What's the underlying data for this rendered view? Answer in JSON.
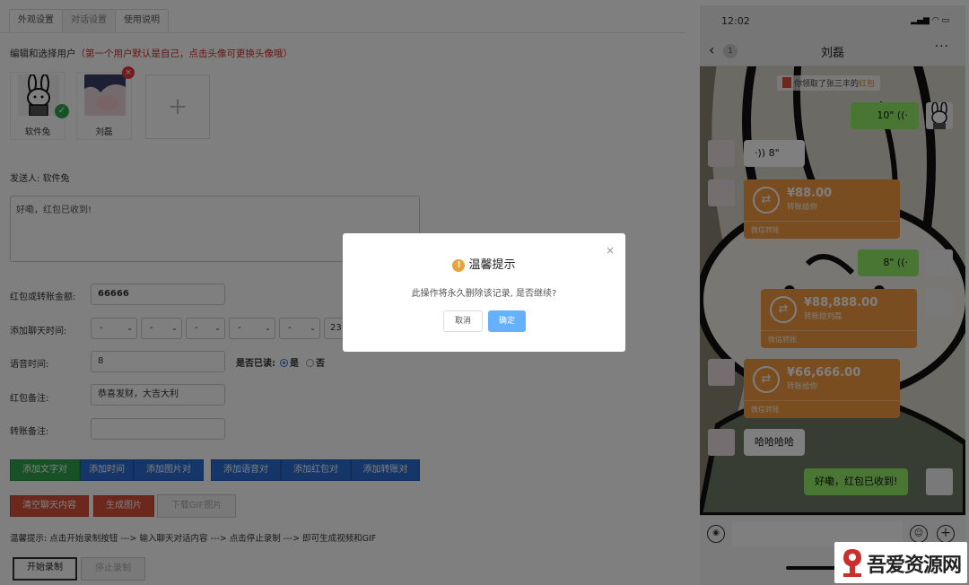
{
  "tabs": [
    {
      "label": "外观设置"
    },
    {
      "label": "对话设置"
    },
    {
      "label": "使用说明"
    }
  ],
  "users_header": {
    "prefix": "编辑和选择用户",
    "note": "（第一个用户默认是自己，点击头像可更换头像哦）"
  },
  "users": [
    {
      "name": "软件兔"
    },
    {
      "name": "刘磊"
    }
  ],
  "add_symbol": "+",
  "sender": {
    "label": "发送人:",
    "name": "软件兔"
  },
  "message_text": "好嘞，红包已收到!",
  "form": {
    "amount_label": "红包或转账金额:",
    "amount_value": "66666",
    "time_label": "添加聊天时间:",
    "time_selects": [
      "-",
      "-",
      "-",
      "-",
      "-",
      "23"
    ],
    "voice_label": "语音时间:",
    "voice_value": "8",
    "read_label": "是否已读:",
    "read_yes": "是",
    "read_no": "否",
    "hb_note_label": "红包备注:",
    "hb_note_value": "恭喜发财，大吉大利",
    "tf_note_label": "转账备注:",
    "tf_note_value": ""
  },
  "buttons": {
    "add_text": "添加文字对话",
    "add_time": "添加时间",
    "add_image": "添加图片对话",
    "add_voice": "添加语音对话",
    "add_hongbao": "添加红包对话",
    "add_transfer": "添加转账对话",
    "clear": "清空聊天内容",
    "generate": "生成图片",
    "download_gif": "下载GIF图片",
    "start_rec": "开始录制",
    "stop_rec": "停止录制"
  },
  "tip": "温馨提示: 点击开始录制按钮 ---> 输入聊天对话内容 ---> 点击停止录制 ---> 即可生成视频和GIF",
  "dialog": {
    "title": "温馨提示",
    "icon": "!",
    "message": "此操作将永久删除该记录, 是否继续?",
    "cancel": "取消",
    "confirm": "确定",
    "close": "×"
  },
  "phone": {
    "time": "12:02",
    "status_icons": "▂▄▆ ◠ ▭",
    "back": "‹",
    "unread": "1",
    "title": "刘磊",
    "more": "···",
    "sys_msg": {
      "text": "你领取了张三丰的",
      "highlight": "红包"
    },
    "voice_right_1": "10\" ((·",
    "voice_left": "·)) 8\"",
    "voice_right_2": "8\" ((·",
    "transfers": [
      {
        "amount": "¥88.00",
        "sub": "转账给你",
        "footer": "微信转账"
      },
      {
        "amount": "¥88,888.00",
        "sub": "转账给刘磊",
        "footer": "微信转账"
      },
      {
        "amount": "¥66,666.00",
        "sub": "转账给你",
        "footer": "微信转账"
      }
    ],
    "text_left": "哈哈哈哈",
    "text_right": "好嘞，红包已收到!",
    "transfer_icon": "⇄",
    "voice_btn": "◉",
    "emoji_btn": "☺",
    "plus_btn": "+"
  },
  "watermark": "吾爱资源网",
  "colors": {
    "green": "#2ea44f",
    "blue": "#2b6dd1",
    "red": "#d9503a",
    "wechat_green": "#95ec69",
    "transfer_orange": "#f29a3e",
    "dialog_confirm": "#66b1ff",
    "warn": "#e6a23c"
  }
}
